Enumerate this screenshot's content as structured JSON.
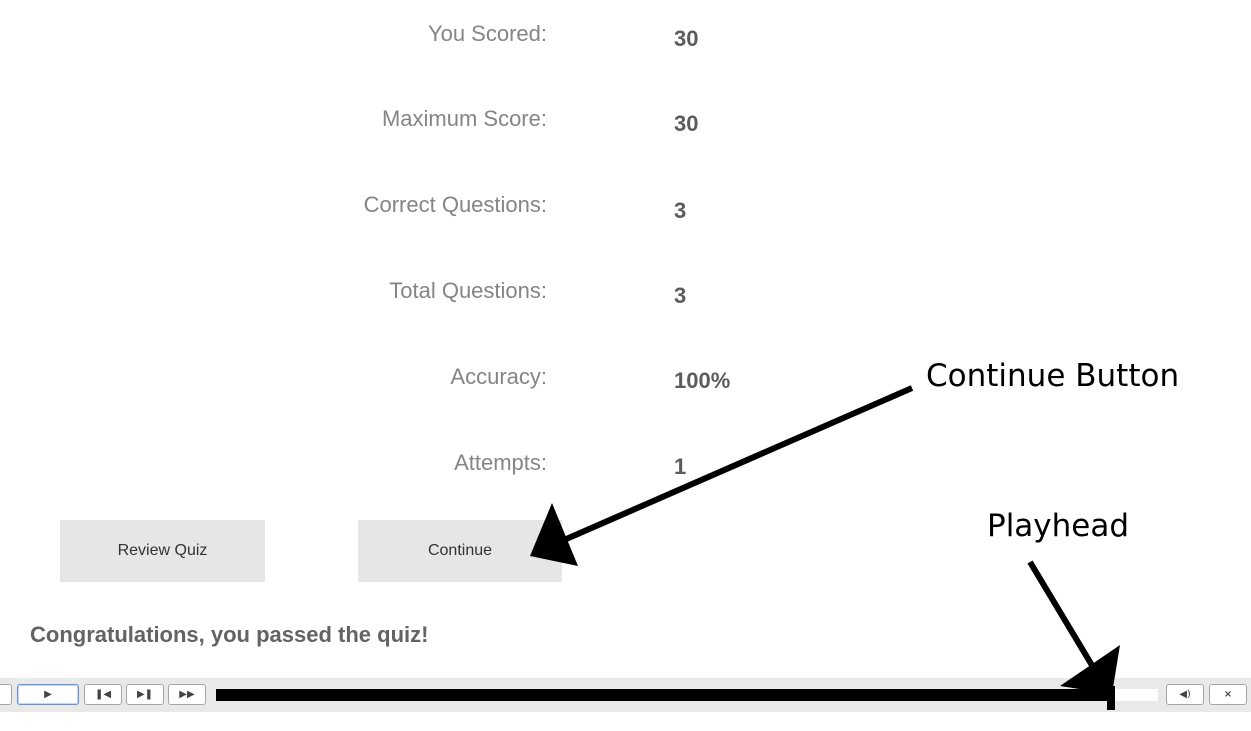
{
  "results": [
    {
      "label": "You Scored:",
      "value": "30"
    },
    {
      "label": "Maximum Score:",
      "value": "30"
    },
    {
      "label": "Correct Questions:",
      "value": "3"
    },
    {
      "label": "Total Questions:",
      "value": "3"
    },
    {
      "label": "Accuracy:",
      "value": "100%"
    },
    {
      "label": "Attempts:",
      "value": "1"
    }
  ],
  "buttons": {
    "review": "Review Quiz",
    "continue": "Continue"
  },
  "message": "Congratulations, you passed the quiz!",
  "playbar": {
    "icons": [
      "play-icon",
      "rewind-icon",
      "forward-icon",
      "fast-forward-icon",
      "volume-icon",
      "close-icon"
    ],
    "progress_fraction": 0.95
  },
  "annotations": {
    "continue": "Continue Button",
    "playhead": "Playhead"
  }
}
